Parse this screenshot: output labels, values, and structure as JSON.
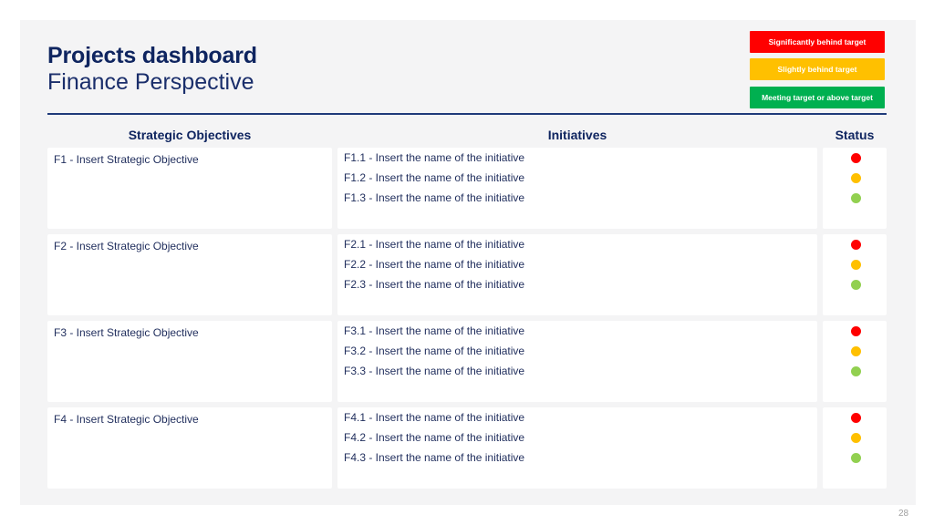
{
  "header": {
    "title": "Projects dashboard",
    "subtitle": "Finance Perspective"
  },
  "legend": [
    {
      "label": "Significantly behind target",
      "color": "#ff0000",
      "status": "red"
    },
    {
      "label": "Slightly behind target",
      "color": "#ffc000",
      "status": "amber"
    },
    {
      "label": "Meeting target or above target",
      "color": "#00b050",
      "status": "green"
    }
  ],
  "columns": {
    "objectives": "Strategic Objectives",
    "initiatives": "Initiatives",
    "status": "Status"
  },
  "status_colors": {
    "red": "#ff0000",
    "amber": "#ffc000",
    "green": "#92d050"
  },
  "rows": [
    {
      "objective": "F1 - Insert Strategic Objective",
      "initiatives": [
        {
          "name": "F1.1 - Insert the name of the initiative",
          "status": "red"
        },
        {
          "name": "F1.2 - Insert the name of the initiative",
          "status": "amber"
        },
        {
          "name": "F1.3 - Insert the name of the initiative",
          "status": "green"
        }
      ]
    },
    {
      "objective": "F2 - Insert Strategic Objective",
      "initiatives": [
        {
          "name": "F2.1 - Insert the name of the initiative",
          "status": "red"
        },
        {
          "name": "F2.2 - Insert the name of the initiative",
          "status": "amber"
        },
        {
          "name": "F2.3 - Insert the name of the initiative",
          "status": "green"
        }
      ]
    },
    {
      "objective": "F3 - Insert Strategic Objective",
      "initiatives": [
        {
          "name": "F3.1 - Insert the name of the initiative",
          "status": "red"
        },
        {
          "name": "F3.2 - Insert the name of the initiative",
          "status": "amber"
        },
        {
          "name": "F3.3 - Insert the name of the initiative",
          "status": "green"
        }
      ]
    },
    {
      "objective": "F4 - Insert Strategic Objective",
      "initiatives": [
        {
          "name": "F4.1 - Insert the name of the initiative",
          "status": "red"
        },
        {
          "name": "F4.2 - Insert the name of the initiative",
          "status": "amber"
        },
        {
          "name": "F4.3 - Insert the name of the initiative",
          "status": "green"
        }
      ]
    }
  ],
  "page_number": "28"
}
